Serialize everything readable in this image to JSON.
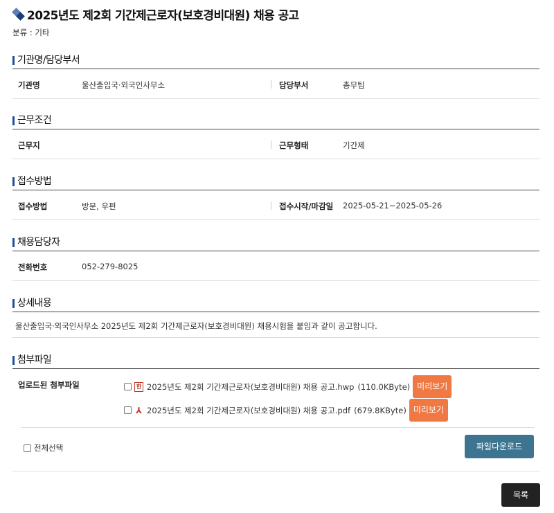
{
  "title": "2025년도 제2회 기간제근로자(보호경비대원) 채용 공고",
  "category": "분류 : 기타",
  "sections": {
    "org": {
      "heading": "기관명/담당부서",
      "label1": "기관명",
      "value1": "울산출입국·외국인사무소",
      "label2": "담당부서",
      "value2": "총무팀"
    },
    "work": {
      "heading": "근무조건",
      "label1": "근무지",
      "value1": "",
      "label2": "근무형태",
      "value2": "기간제"
    },
    "receipt": {
      "heading": "접수방법",
      "label1": "접수방법",
      "value1": "방문, 우편",
      "label2": "접수시작/마감일",
      "value2": "2025-05-21~2025-05-26"
    },
    "contact": {
      "heading": "채용담당자",
      "label1": "전화번호",
      "value1": "052-279-8025"
    },
    "detail": {
      "heading": "상세내용",
      "text": "울산출입국·외국인사무소 2025년도 제2회 기간제근로자(보호경비대원) 채용시험을 붙임과 같이 공고합니다."
    },
    "attachments": {
      "heading": "첨부파일",
      "label": "업로드된 첨부파일",
      "files": [
        {
          "name": "2025년도 제2회 기간제근로자(보호경비대원) 채용 공고.hwp",
          "size": "(110.0KByte)",
          "icon": "hwp-file-icon",
          "preview": "미리보기"
        },
        {
          "name": "2025년도 제2회 기간제근로자(보호경비대원) 채용 공고.pdf",
          "size": "(679.8KByte)",
          "icon": "pdf-file-icon",
          "preview": "미리보기"
        }
      ],
      "select_all": "전체선택",
      "download": "파일다운로드"
    }
  },
  "list_button": "목록",
  "colors": {
    "accent": "#1f4f96",
    "preview": "#f07843",
    "download": "#3d7591",
    "list": "#222222"
  }
}
